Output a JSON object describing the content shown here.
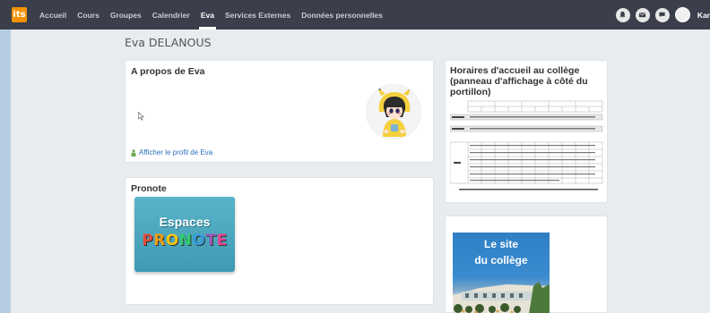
{
  "navbar": {
    "logo_text": "its",
    "items": [
      {
        "label": "Accueil",
        "active": false
      },
      {
        "label": "Cours",
        "active": false
      },
      {
        "label": "Groupes",
        "active": false
      },
      {
        "label": "Calendrier",
        "active": false
      },
      {
        "label": "Eva",
        "active": true
      },
      {
        "label": "Services Externes",
        "active": false
      },
      {
        "label": "Données personnelles",
        "active": false
      }
    ],
    "right_icons": [
      "bell-icon",
      "mail-icon",
      "chat-icon"
    ],
    "user_name": "Kar"
  },
  "page": {
    "title": "Eva DELANOUS"
  },
  "about": {
    "title": "A propos de Eva",
    "link_label": "Afficher le profil de Eva"
  },
  "pronote": {
    "title": "Pronote",
    "banner_line1": "Espaces",
    "banner_line2": "PRONOTE"
  },
  "horaires": {
    "title": "Horaires d'accueil au collège (panneau d'affichage à côté du portillon)"
  },
  "site": {
    "line1": "Le site",
    "line2": "du collège"
  },
  "colors": {
    "navbar_bg": "#3b3f4b",
    "accent_orange": "#f39200",
    "link_blue": "#2a6ebb",
    "left_strip": "#b7cce0"
  }
}
